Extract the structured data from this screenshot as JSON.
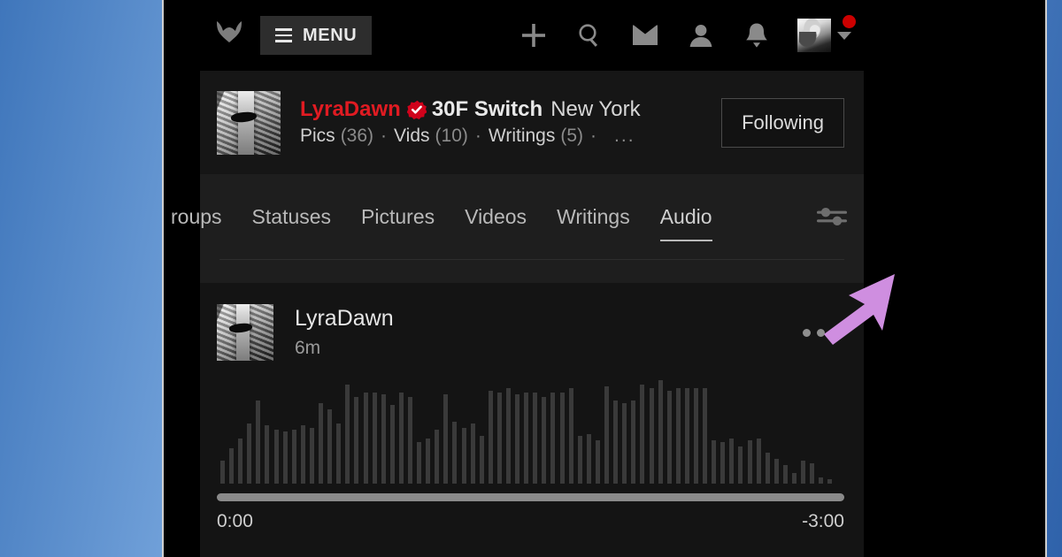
{
  "topnav": {
    "logo_name": "fetlife-logo",
    "menu_label": "MENU",
    "icons": [
      {
        "name": "plus-icon",
        "label": "Create"
      },
      {
        "name": "search-icon",
        "label": "Search"
      },
      {
        "name": "envelope-icon",
        "label": "Messages"
      },
      {
        "name": "person-icon",
        "label": "Friends"
      },
      {
        "name": "bell-icon",
        "label": "Notifications"
      }
    ],
    "avatar_has_notification": true
  },
  "profile": {
    "username": "LyraDawn",
    "verified": true,
    "age_role": "30F Switch",
    "location": "New York",
    "stats": [
      {
        "label": "Pics",
        "count": "(36)"
      },
      {
        "label": "Vids",
        "count": "(10)"
      },
      {
        "label": "Writings",
        "count": "(5)"
      }
    ],
    "separator": "·",
    "more": "...",
    "follow_label": "Following",
    "username_color": "#e01b22"
  },
  "tabs": {
    "items": [
      {
        "label": "roups",
        "active": false,
        "clipped": true
      },
      {
        "label": "Statuses",
        "active": false
      },
      {
        "label": "Pictures",
        "active": false
      },
      {
        "label": "Videos",
        "active": false
      },
      {
        "label": "Writings",
        "active": false
      },
      {
        "label": "Audio",
        "active": true
      }
    ],
    "filter_icon": "sliders-icon"
  },
  "post": {
    "author": "LyraDawn",
    "timestamp": "6m",
    "menu_icon": "more-options-icon"
  },
  "player": {
    "time_elapsed": "0:00",
    "time_remaining": "-3:00",
    "progress_percent": 100,
    "bar_color": "#8a8a8a",
    "wave_color": "#3a3a3a",
    "waveform": [
      22,
      34,
      44,
      58,
      80,
      56,
      52,
      50,
      52,
      56,
      54,
      78,
      72,
      58,
      96,
      84,
      88,
      88,
      86,
      76,
      88,
      84,
      40,
      44,
      52,
      86,
      60,
      54,
      58,
      46,
      90,
      88,
      92,
      86,
      88,
      88,
      84,
      88,
      88,
      92,
      46,
      48,
      42,
      94,
      80,
      78,
      80,
      96,
      92,
      100,
      90,
      92,
      92,
      92,
      92,
      42,
      40,
      44,
      36,
      42,
      44,
      30,
      24,
      18,
      10,
      22,
      20,
      6,
      4
    ]
  },
  "cursor": {
    "name": "mouse-cursor-arrow",
    "color": "#cf8ee0"
  }
}
